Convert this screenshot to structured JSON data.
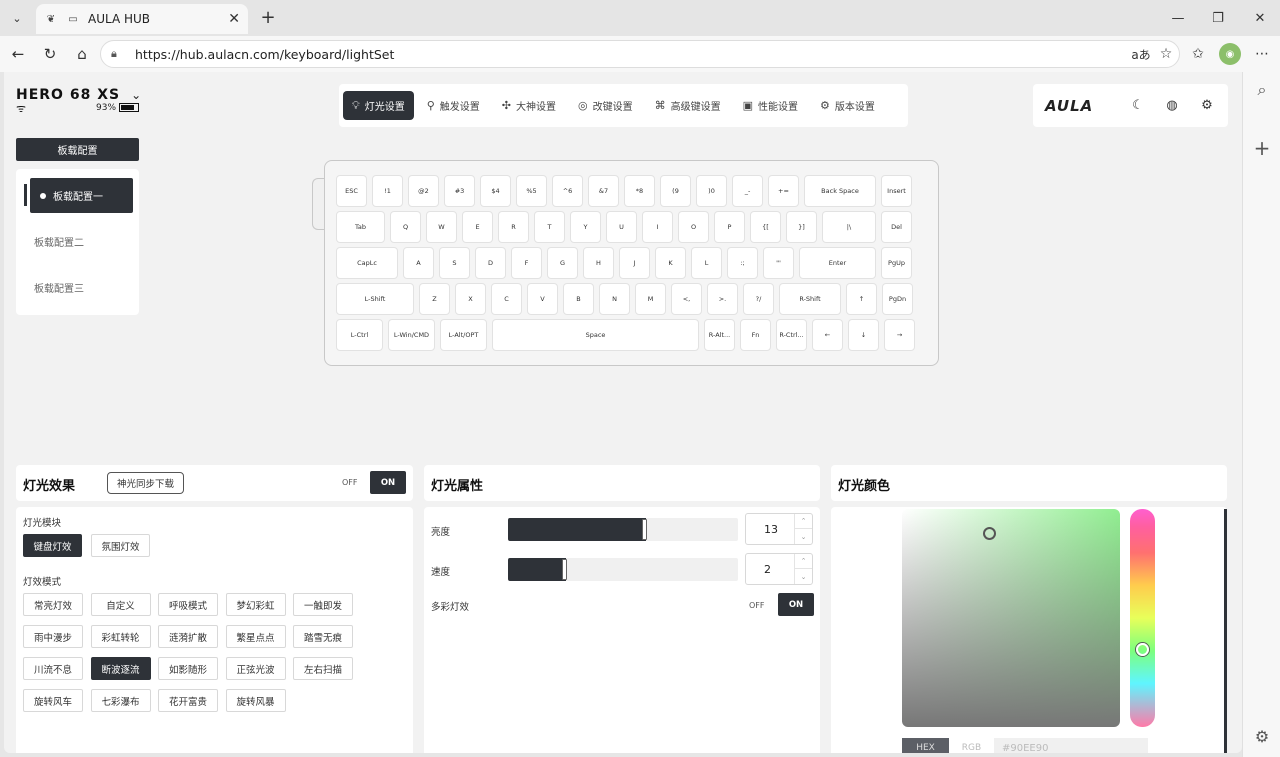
{
  "browser": {
    "tab_title": "AULA HUB",
    "url": "https://hub.aulacn.com/keyboard/lightSet"
  },
  "device": {
    "name": "HERO 68 XS",
    "battery": "93%"
  },
  "topnav": {
    "items": [
      {
        "label": "灯光设置",
        "icon": "bulb-icon"
      },
      {
        "label": "触发设置",
        "icon": "trigger-icon"
      },
      {
        "label": "大神设置",
        "icon": "macro-icon"
      },
      {
        "label": "改键设置",
        "icon": "keymap-icon"
      },
      {
        "label": "高级键设置",
        "icon": "command-icon"
      },
      {
        "label": "性能设置",
        "icon": "chip-icon"
      },
      {
        "label": "版本设置",
        "icon": "version-icon"
      }
    ],
    "active": "灯光设置"
  },
  "brand": {
    "logo": "AULA"
  },
  "config": {
    "button_label": "板载配置",
    "items": [
      "板载配置一",
      "板载配置二",
      "板载配置三"
    ],
    "active": "板载配置一"
  },
  "keyboard": {
    "rows": [
      [
        "ESC",
        "!1",
        "@2",
        "#3",
        "$4",
        "%5",
        "^6",
        "&7",
        "*8",
        "(9",
        ")0",
        "_-",
        "+=",
        "Back Space",
        "Insert"
      ],
      [
        "Tab",
        "Q",
        "W",
        "E",
        "R",
        "T",
        "Y",
        "U",
        "I",
        "O",
        "P",
        "{[",
        "}]",
        "|\\",
        "Del"
      ],
      [
        "CapLc",
        "A",
        "S",
        "D",
        "F",
        "G",
        "H",
        "J",
        "K",
        "L",
        ":;",
        "\"'",
        "Enter",
        "PgUp"
      ],
      [
        "L-Shift",
        "Z",
        "X",
        "C",
        "V",
        "B",
        "N",
        "M",
        "<,",
        ">.",
        "?/",
        "R-Shift",
        "↑",
        "PgDn"
      ],
      [
        "L-Ctrl",
        "L-Win/CMD",
        "L-Alt/OPT",
        "Space",
        "R-Alt...",
        "Fn",
        "R-Ctrl...",
        "←",
        "↓",
        "→"
      ]
    ]
  },
  "effects": {
    "title": "灯光效果",
    "sync_label": "神光同步下载",
    "off": "OFF",
    "on": "ON",
    "module_label": "灯光模块",
    "modules": [
      "键盘灯效",
      "氛围灯效"
    ],
    "module_active": "键盘灯效",
    "mode_label": "灯效模式",
    "modes": [
      [
        "常亮灯效",
        "自定义",
        "呼吸模式",
        "梦幻彩虹",
        "一触即发"
      ],
      [
        "雨中漫步",
        "彩虹转轮",
        "涟漪扩散",
        "繁星点点",
        "踏雪无痕"
      ],
      [
        "川流不息",
        "断波逐流",
        "如影随形",
        "正弦光波",
        "左右扫描"
      ],
      [
        "旋转风车",
        "七彩瀑布",
        "花开富贵",
        "旋转风暴"
      ]
    ],
    "mode_active": "断波逐流"
  },
  "attributes": {
    "title": "灯光属性",
    "brightness_label": "亮度",
    "brightness": 13,
    "brightness_fraction": 0.6,
    "speed_label": "速度",
    "speed": 2,
    "speed_fraction": 0.25,
    "multicolor_label": "多彩灯效",
    "off": "OFF",
    "on": "ON"
  },
  "color": {
    "title": "灯光颜色",
    "hex_tab": "HEX",
    "rgb_tab": "RGB",
    "hex_value": "#90EE90",
    "accent": "#90EE90"
  }
}
